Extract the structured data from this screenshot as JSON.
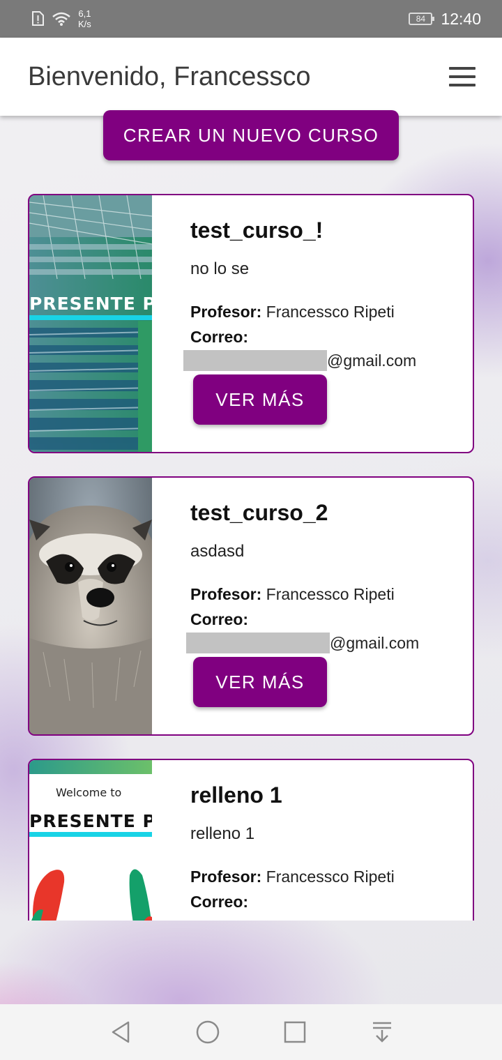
{
  "status_bar": {
    "net_speed_value": "6,1",
    "net_speed_unit": "K/s",
    "battery": "84",
    "time": "12:40"
  },
  "app_bar": {
    "title": "Bienvenido, Francessco",
    "menu_icon": "hamburger-menu-icon"
  },
  "actions": {
    "create_course_label": "CREAR UN NUEVO CURSO"
  },
  "courses": [
    {
      "title": "test_curso_!",
      "description": "no lo se",
      "professor_label": "Profesor:",
      "professor": "Francessco Ripeti",
      "email_label": "Correo:",
      "email_suffix": "@gmail.com",
      "button_label": "VER MÁS",
      "image_text": "PRESENTE P"
    },
    {
      "title": "test_curso_2",
      "description": "asdasd",
      "professor_label": "Profesor:",
      "professor": "Francessco Ripeti",
      "email_label": "Correo:",
      "email_suffix": "@gmail.com",
      "button_label": "VER MÁS"
    },
    {
      "title": "relleno 1",
      "description": "relleno 1",
      "professor_label": "Profesor:",
      "professor": "Francessco Ripeti",
      "email_label": "Correo:",
      "image_welcome": "Welcome to",
      "image_text": "PRESENTE P"
    }
  ],
  "colors": {
    "primary": "#800080",
    "card_border": "#800080"
  },
  "nav_bar": {
    "icons": [
      "back-icon",
      "home-icon",
      "recents-icon",
      "notifications-pull-icon"
    ]
  }
}
